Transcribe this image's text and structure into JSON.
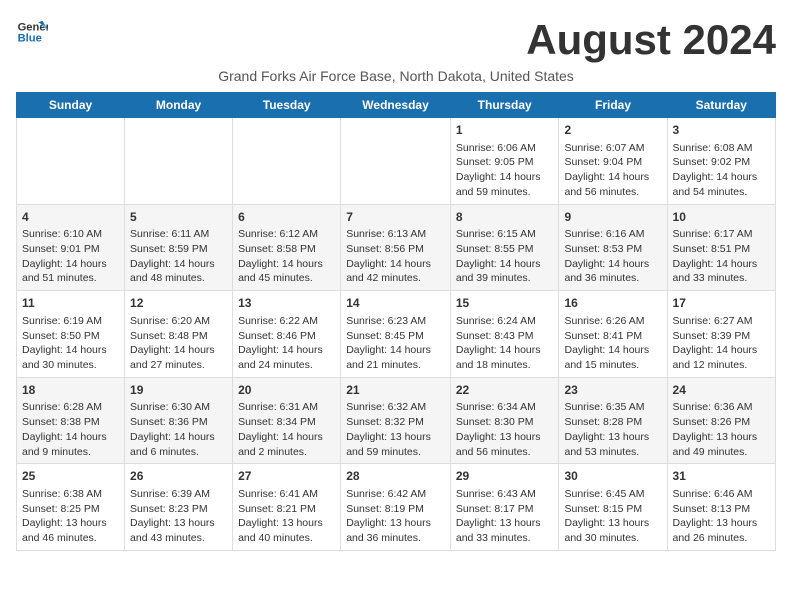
{
  "logo": {
    "line1": "General",
    "line2": "Blue"
  },
  "title": "August 2024",
  "subtitle": "Grand Forks Air Force Base, North Dakota, United States",
  "days_of_week": [
    "Sunday",
    "Monday",
    "Tuesday",
    "Wednesday",
    "Thursday",
    "Friday",
    "Saturday"
  ],
  "weeks": [
    [
      {
        "day": "",
        "info": ""
      },
      {
        "day": "",
        "info": ""
      },
      {
        "day": "",
        "info": ""
      },
      {
        "day": "",
        "info": ""
      },
      {
        "day": "1",
        "info": "Sunrise: 6:06 AM\nSunset: 9:05 PM\nDaylight: 14 hours\nand 59 minutes."
      },
      {
        "day": "2",
        "info": "Sunrise: 6:07 AM\nSunset: 9:04 PM\nDaylight: 14 hours\nand 56 minutes."
      },
      {
        "day": "3",
        "info": "Sunrise: 6:08 AM\nSunset: 9:02 PM\nDaylight: 14 hours\nand 54 minutes."
      }
    ],
    [
      {
        "day": "4",
        "info": "Sunrise: 6:10 AM\nSunset: 9:01 PM\nDaylight: 14 hours\nand 51 minutes."
      },
      {
        "day": "5",
        "info": "Sunrise: 6:11 AM\nSunset: 8:59 PM\nDaylight: 14 hours\nand 48 minutes."
      },
      {
        "day": "6",
        "info": "Sunrise: 6:12 AM\nSunset: 8:58 PM\nDaylight: 14 hours\nand 45 minutes."
      },
      {
        "day": "7",
        "info": "Sunrise: 6:13 AM\nSunset: 8:56 PM\nDaylight: 14 hours\nand 42 minutes."
      },
      {
        "day": "8",
        "info": "Sunrise: 6:15 AM\nSunset: 8:55 PM\nDaylight: 14 hours\nand 39 minutes."
      },
      {
        "day": "9",
        "info": "Sunrise: 6:16 AM\nSunset: 8:53 PM\nDaylight: 14 hours\nand 36 minutes."
      },
      {
        "day": "10",
        "info": "Sunrise: 6:17 AM\nSunset: 8:51 PM\nDaylight: 14 hours\nand 33 minutes."
      }
    ],
    [
      {
        "day": "11",
        "info": "Sunrise: 6:19 AM\nSunset: 8:50 PM\nDaylight: 14 hours\nand 30 minutes."
      },
      {
        "day": "12",
        "info": "Sunrise: 6:20 AM\nSunset: 8:48 PM\nDaylight: 14 hours\nand 27 minutes."
      },
      {
        "day": "13",
        "info": "Sunrise: 6:22 AM\nSunset: 8:46 PM\nDaylight: 14 hours\nand 24 minutes."
      },
      {
        "day": "14",
        "info": "Sunrise: 6:23 AM\nSunset: 8:45 PM\nDaylight: 14 hours\nand 21 minutes."
      },
      {
        "day": "15",
        "info": "Sunrise: 6:24 AM\nSunset: 8:43 PM\nDaylight: 14 hours\nand 18 minutes."
      },
      {
        "day": "16",
        "info": "Sunrise: 6:26 AM\nSunset: 8:41 PM\nDaylight: 14 hours\nand 15 minutes."
      },
      {
        "day": "17",
        "info": "Sunrise: 6:27 AM\nSunset: 8:39 PM\nDaylight: 14 hours\nand 12 minutes."
      }
    ],
    [
      {
        "day": "18",
        "info": "Sunrise: 6:28 AM\nSunset: 8:38 PM\nDaylight: 14 hours\nand 9 minutes."
      },
      {
        "day": "19",
        "info": "Sunrise: 6:30 AM\nSunset: 8:36 PM\nDaylight: 14 hours\nand 6 minutes."
      },
      {
        "day": "20",
        "info": "Sunrise: 6:31 AM\nSunset: 8:34 PM\nDaylight: 14 hours\nand 2 minutes."
      },
      {
        "day": "21",
        "info": "Sunrise: 6:32 AM\nSunset: 8:32 PM\nDaylight: 13 hours\nand 59 minutes."
      },
      {
        "day": "22",
        "info": "Sunrise: 6:34 AM\nSunset: 8:30 PM\nDaylight: 13 hours\nand 56 minutes."
      },
      {
        "day": "23",
        "info": "Sunrise: 6:35 AM\nSunset: 8:28 PM\nDaylight: 13 hours\nand 53 minutes."
      },
      {
        "day": "24",
        "info": "Sunrise: 6:36 AM\nSunset: 8:26 PM\nDaylight: 13 hours\nand 49 minutes."
      }
    ],
    [
      {
        "day": "25",
        "info": "Sunrise: 6:38 AM\nSunset: 8:25 PM\nDaylight: 13 hours\nand 46 minutes."
      },
      {
        "day": "26",
        "info": "Sunrise: 6:39 AM\nSunset: 8:23 PM\nDaylight: 13 hours\nand 43 minutes."
      },
      {
        "day": "27",
        "info": "Sunrise: 6:41 AM\nSunset: 8:21 PM\nDaylight: 13 hours\nand 40 minutes."
      },
      {
        "day": "28",
        "info": "Sunrise: 6:42 AM\nSunset: 8:19 PM\nDaylight: 13 hours\nand 36 minutes."
      },
      {
        "day": "29",
        "info": "Sunrise: 6:43 AM\nSunset: 8:17 PM\nDaylight: 13 hours\nand 33 minutes."
      },
      {
        "day": "30",
        "info": "Sunrise: 6:45 AM\nSunset: 8:15 PM\nDaylight: 13 hours\nand 30 minutes."
      },
      {
        "day": "31",
        "info": "Sunrise: 6:46 AM\nSunset: 8:13 PM\nDaylight: 13 hours\nand 26 minutes."
      }
    ]
  ]
}
